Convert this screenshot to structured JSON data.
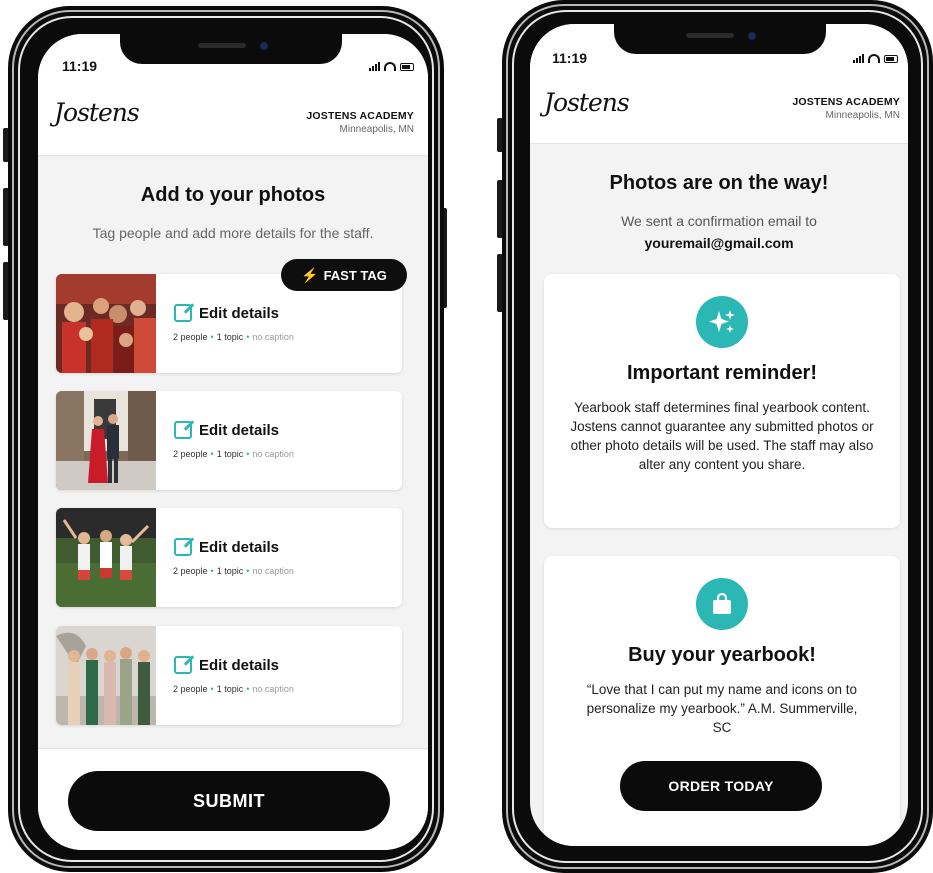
{
  "left_phone": {
    "status": {
      "time": "11:19"
    },
    "header": {
      "logo": "Jostens",
      "school_name": "JOSTENS ACADEMY",
      "school_location": "Minneapolis, MN"
    },
    "title": "Add to your photos",
    "subtitle": "Tag people and add more details for the staff.",
    "fast_tag_label": "FAST TAG",
    "photos": [
      {
        "edit_label": "Edit details",
        "people": "2 people",
        "topic": "1 topic",
        "caption": "no caption"
      },
      {
        "edit_label": "Edit details",
        "people": "2 people",
        "topic": "1 topic",
        "caption": "no caption"
      },
      {
        "edit_label": "Edit details",
        "people": "2 people",
        "topic": "1 topic",
        "caption": "no caption"
      },
      {
        "edit_label": "Edit details",
        "people": "2 people",
        "topic": "1 topic",
        "caption": "no caption"
      }
    ],
    "submit_label": "SUBMIT"
  },
  "right_phone": {
    "status": {
      "time": "11:19"
    },
    "header": {
      "logo": "Jostens",
      "school_name": "JOSTENS ACADEMY",
      "school_location": "Minneapolis, MN"
    },
    "title": "Photos are on the way!",
    "subtitle": "We sent a confirmation email to",
    "email": "youremail@gmail.com",
    "reminder": {
      "icon": "sparkle-icon",
      "title": "Important reminder!",
      "body": "Yearbook staff determines final yearbook content. Jostens cannot guarantee any submitted photos or other photo details will be used. The staff may also alter any content you share."
    },
    "yearbook": {
      "icon": "shopping-bag-icon",
      "title": "Buy your yearbook!",
      "body": "“Love that I can put my name and icons on to personalize my yearbook.” A.M. Summerville, SC",
      "button_label": "ORDER TODAY"
    }
  },
  "colors": {
    "accent": "#2bb7b3",
    "button": "#0b0b0b",
    "background": "#f3f3f3"
  }
}
